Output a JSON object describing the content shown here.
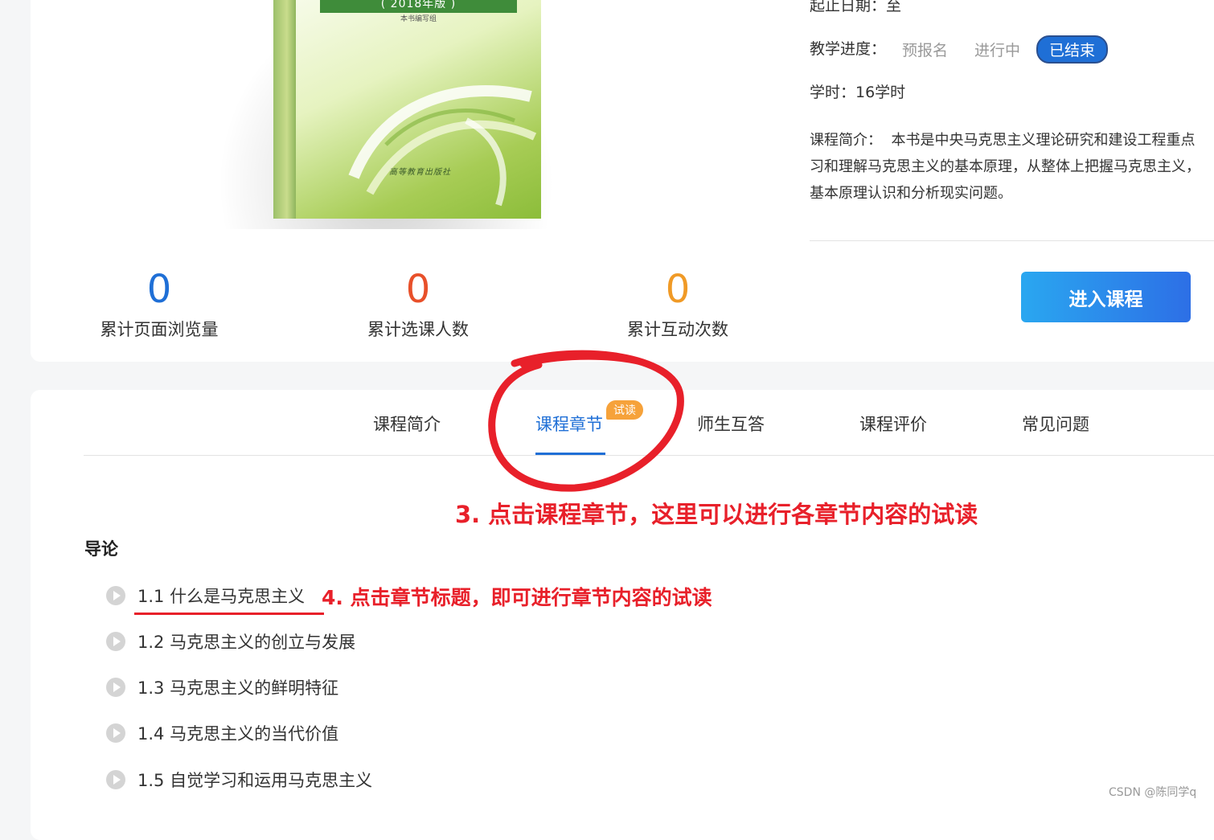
{
  "book": {
    "edition_band": "( 2018年版 )",
    "subtitle": "本书编写组",
    "spine_text": "(2018年版) 本书编写组",
    "publisher": "高等教育出版社"
  },
  "info": {
    "date_label": "起止日期：至",
    "progress_label": "教学进度：",
    "progress_options": [
      "预报名",
      "进行中",
      "已结束"
    ],
    "hours": "学时：16学时",
    "desc_label": "课程简介：",
    "desc_lines": [
      "本书是中央马克思主义理论研究和建设工程重点",
      "习和理解马克思主义的基本原理，从整体上把握马克思主义，",
      "基本原理认识和分析现实问题。"
    ]
  },
  "stats": [
    {
      "value": "0",
      "label": "累计页面浏览量",
      "color": "#1f6fd6"
    },
    {
      "value": "0",
      "label": "累计选课人数",
      "color": "#e8502a"
    },
    {
      "value": "0",
      "label": "累计互动次数",
      "color": "#f09a26"
    }
  ],
  "enter_button": "进入课程",
  "tabs": [
    "课程简介",
    "课程章节",
    "师生互答",
    "课程评价",
    "常见问题"
  ],
  "active_tab_badge": "试读",
  "annotations": {
    "step3": "3. 点击课程章节，这里可以进行各章节内容的试读",
    "step4": "4. 点击章节标题，即可进行章节内容的试读"
  },
  "section_title": "导论",
  "chapters": [
    "1.1 什么是马克思主义",
    "1.2 马克思主义的创立与发展",
    "1.3 马克思主义的鲜明特征",
    "1.4 马克思主义的当代价值",
    "1.5 自觉学习和运用马克思主义"
  ],
  "watermark": "CSDN @陈同学q",
  "colors": {
    "accent": "#1f6fd6",
    "annotation_red": "#e8202a",
    "badge_orange": "#f6a23a"
  }
}
